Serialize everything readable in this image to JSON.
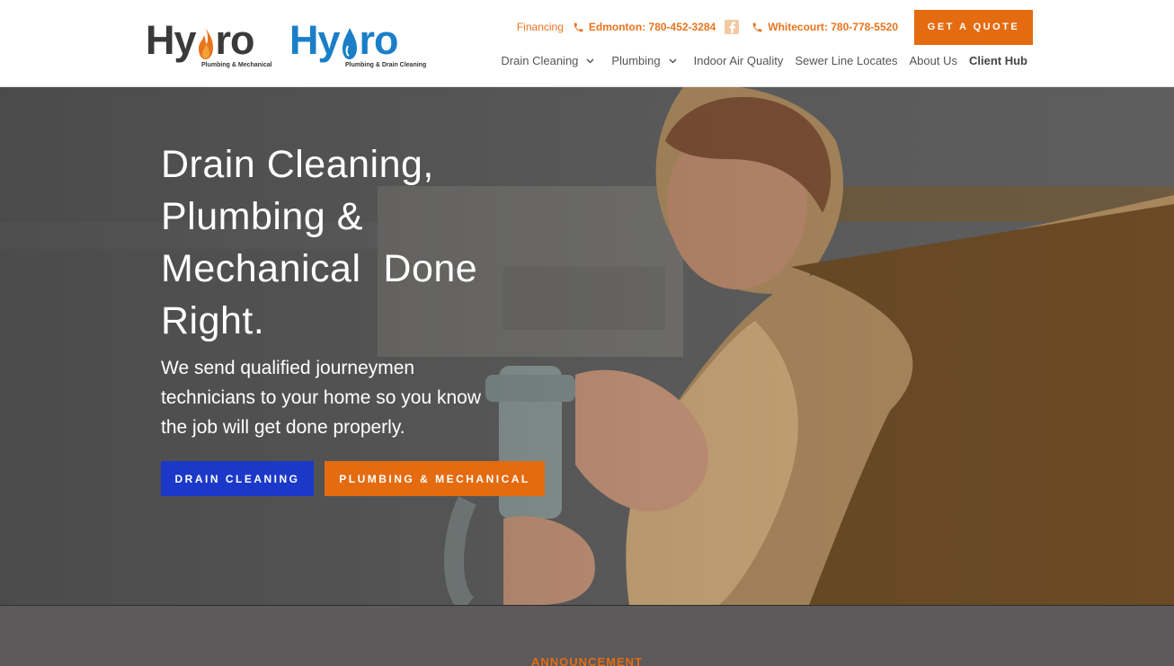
{
  "header": {
    "logo_primary": {
      "text_left": "Hy",
      "text_right": "ro",
      "tagline": "Plumbing & Mechanical"
    },
    "logo_secondary": {
      "text_left": "Hy",
      "text_right": "ro",
      "tagline": "Plumbing & Drain Cleaning"
    },
    "topbar": {
      "financing": "Financing",
      "phone_edmonton": "Edmonton: 780-452-3284",
      "facebook_icon": "facebook-icon",
      "phone_whitecourt": "Whitecourt: 780-778-5520",
      "quote_button": "GET A QUOTE"
    },
    "nav": [
      {
        "label": "Drain Cleaning",
        "has_dropdown": true
      },
      {
        "label": "Plumbing",
        "has_dropdown": true
      },
      {
        "label": "Indoor Air Quality",
        "has_dropdown": false
      },
      {
        "label": "Sewer Line Locates",
        "has_dropdown": false
      },
      {
        "label": "About Us",
        "has_dropdown": false
      },
      {
        "label": "Client Hub",
        "has_dropdown": false
      }
    ]
  },
  "hero": {
    "title_lines": [
      "Drain Cleaning,",
      "Plumbing &",
      "Mechanical  Done",
      "Right."
    ],
    "subtitle": "We send qualified journeymen technicians to your home so you know the job will get done properly.",
    "buttons": {
      "drain": "DRAIN CLEANING",
      "plumbing": "PLUMBING & MECHANICAL"
    }
  },
  "announcement": {
    "label": "ANNOUNCEMENT"
  },
  "colors": {
    "accent_orange": "#e46b10",
    "accent_blue": "#1b38c9",
    "logo_blue": "#1a7fc8"
  }
}
